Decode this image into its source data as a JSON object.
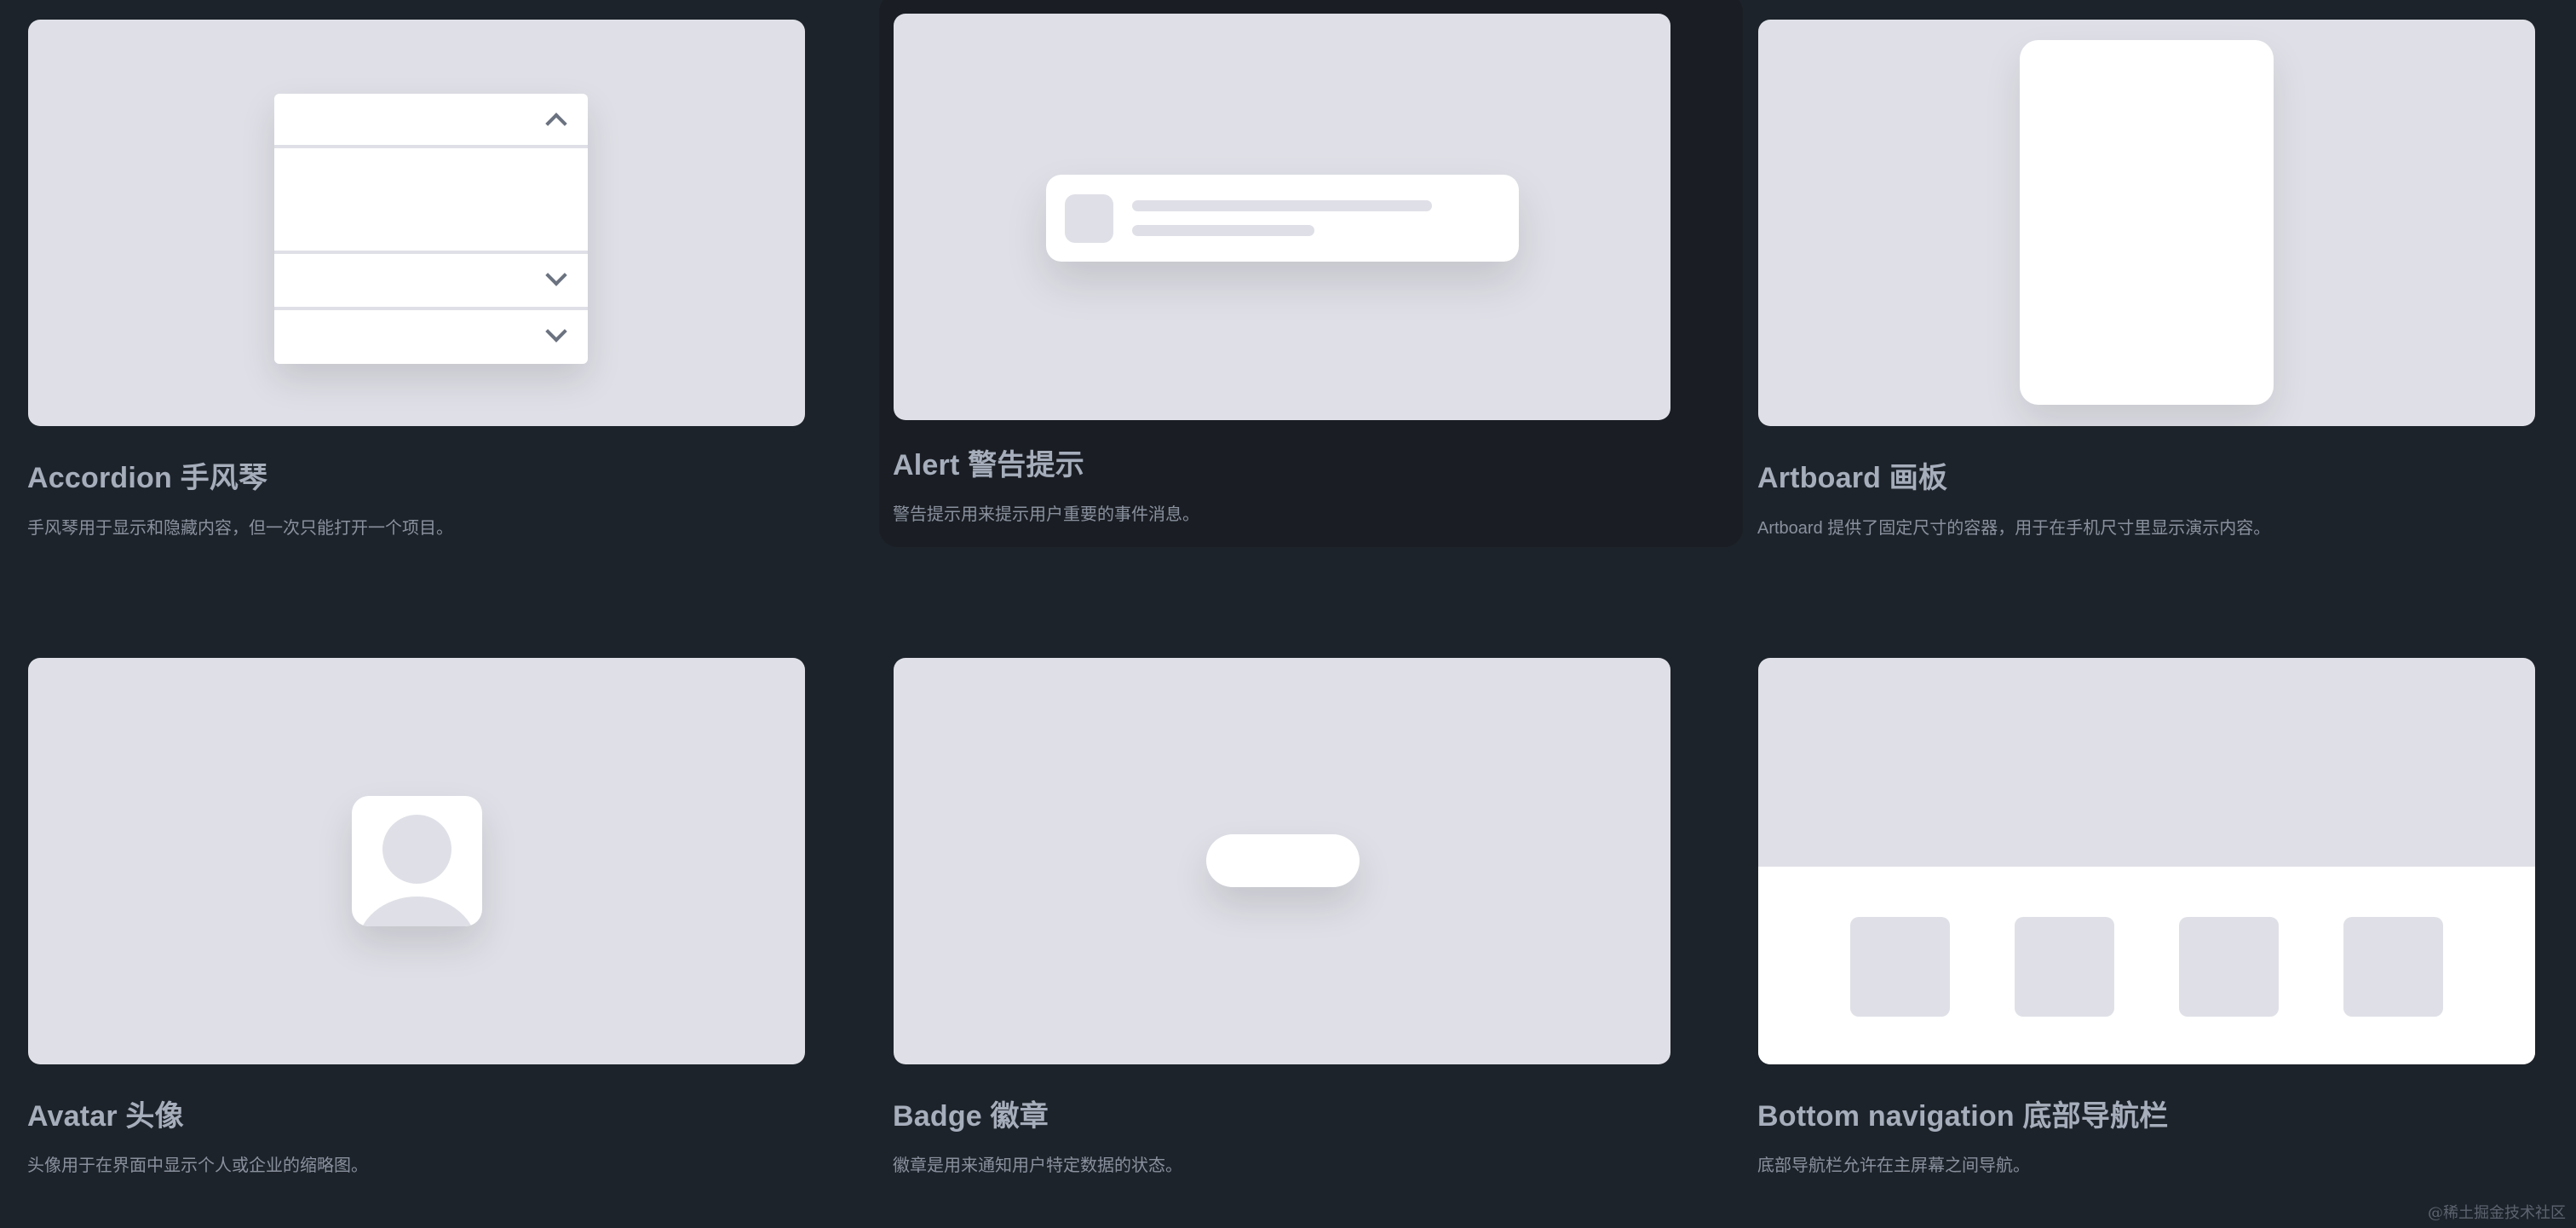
{
  "components": [
    {
      "title": "Accordion 手风琴",
      "description": "手风琴用于显示和隐藏内容，但一次只能打开一个项目。"
    },
    {
      "title": "Alert 警告提示",
      "description": "警告提示用来提示用户重要的事件消息。"
    },
    {
      "title": "Artboard 画板",
      "description": "Artboard 提供了固定尺寸的容器，用于在手机尺寸里显示演示内容。"
    },
    {
      "title": "Avatar 头像",
      "description": "头像用于在界面中显示个人或企业的缩略图。"
    },
    {
      "title": "Badge 徽章",
      "description": "徽章是用来通知用户特定数据的状态。"
    },
    {
      "title": "Bottom navigation 底部导航栏",
      "description": "底部导航栏允许在主屏幕之间导航。"
    }
  ],
  "watermark": "@稀土掘金技术社区",
  "colors": {
    "page_background": "#1d232a",
    "hover_card_background": "#1a1e24",
    "preview_background": "#dfe0e7",
    "title_text": "#a6adbb",
    "description_text": "#8a919e"
  },
  "icons": [
    "chevron-up-icon",
    "chevron-down-icon",
    "avatar-placeholder-icon"
  ]
}
